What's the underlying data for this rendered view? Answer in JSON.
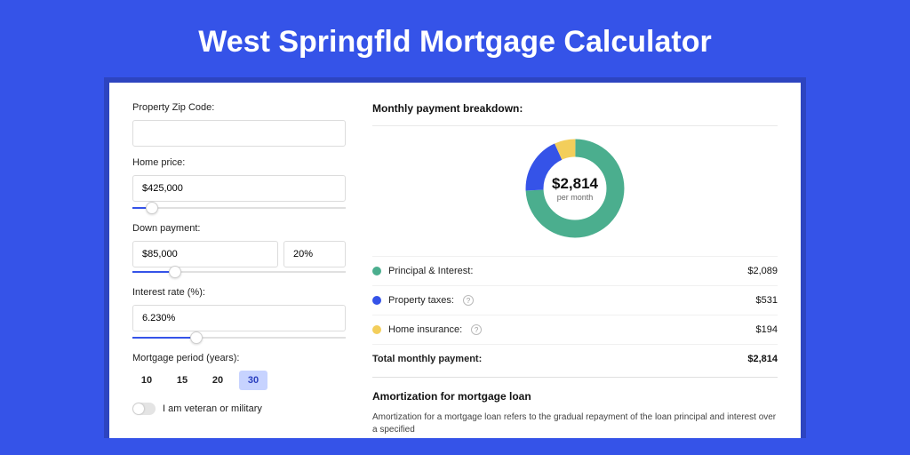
{
  "title": "West Springfld Mortgage Calculator",
  "form": {
    "zip_label": "Property Zip Code:",
    "zip_value": "",
    "home_price_label": "Home price:",
    "home_price_value": "$425,000",
    "home_price_slider_pct": 9,
    "down_payment_label": "Down payment:",
    "down_payment_value": "$85,000",
    "down_payment_pct": "20%",
    "down_payment_slider_pct": 20,
    "interest_label": "Interest rate (%):",
    "interest_value": "6.230%",
    "interest_slider_pct": 30,
    "period_label": "Mortgage period (years):",
    "period_options": [
      "10",
      "15",
      "20",
      "30"
    ],
    "period_active_index": 3,
    "veteran_label": "I am veteran or military"
  },
  "breakdown": {
    "title": "Monthly payment breakdown:",
    "center_amount": "$2,814",
    "center_sub": "per month",
    "items": [
      {
        "label": "Principal & Interest:",
        "value": "$2,089",
        "color": "#4BAE8E",
        "info": false
      },
      {
        "label": "Property taxes:",
        "value": "$531",
        "color": "#3553E8",
        "info": true
      },
      {
        "label": "Home insurance:",
        "value": "$194",
        "color": "#F3CE5B",
        "info": true
      }
    ],
    "total_label": "Total monthly payment:",
    "total_value": "$2,814"
  },
  "amortization": {
    "title": "Amortization for mortgage loan",
    "body": "Amortization for a mortgage loan refers to the gradual repayment of the loan principal and interest over a specified"
  },
  "chart_data": {
    "type": "pie",
    "title": "Monthly payment breakdown",
    "series": [
      {
        "name": "Principal & Interest",
        "value": 2089,
        "color": "#4BAE8E"
      },
      {
        "name": "Property taxes",
        "value": 531,
        "color": "#3553E8"
      },
      {
        "name": "Home insurance",
        "value": 194,
        "color": "#F3CE5B"
      }
    ],
    "total": 2814
  }
}
